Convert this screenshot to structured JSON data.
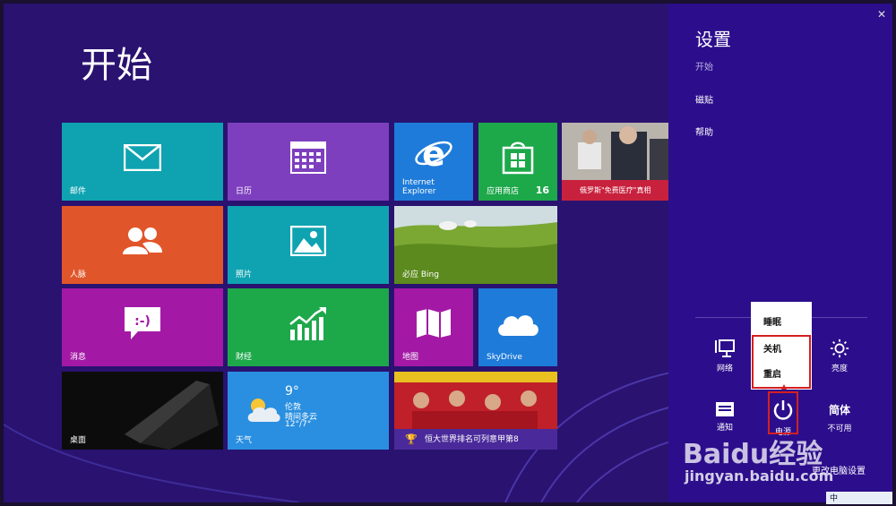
{
  "start": {
    "title": "开始"
  },
  "tiles": {
    "mail": {
      "label": "邮件",
      "color": "#0fa3b1"
    },
    "calendar": {
      "label": "日历",
      "color": "#7e3fbf"
    },
    "ie": {
      "label": "Internet Explorer",
      "color": "#1e7bd9"
    },
    "store": {
      "label": "应用商店",
      "badge": "16",
      "color": "#1da84a"
    },
    "news": {
      "label": "俄罗斯\"免费医疗\"真相",
      "color": "#c8213d"
    },
    "people": {
      "label": "人脉",
      "color": "#e0562a"
    },
    "photos": {
      "label": "照片",
      "color": "#0fa3b1"
    },
    "bing": {
      "label": "必应 Bing"
    },
    "messaging": {
      "label": "消息",
      "color": "#a319a6"
    },
    "finance": {
      "label": "财经",
      "color": "#1da84a"
    },
    "maps": {
      "label": "地图",
      "color": "#a319a6"
    },
    "skydrive": {
      "label": "SkyDrive",
      "color": "#1e7bd9"
    },
    "desktop": {
      "label": "桌面"
    },
    "weather": {
      "label": "天气",
      "temp": "9°",
      "city": "伦敦",
      "condition": "晴间多云",
      "range": "12°/7°",
      "color": "#2a8fe0"
    },
    "sports": {
      "label": "恒大世界排名可列意甲第8",
      "color": "#4a2a9a"
    }
  },
  "charm": {
    "title": "设置",
    "links": [
      "开始",
      "磁贴",
      "帮助"
    ],
    "close": "✕",
    "quick": {
      "network": "网络",
      "brightness": "亮度",
      "notifications": "通知",
      "power": "电源",
      "ime_label": "简体",
      "ime_status": "不可用"
    },
    "power_menu": [
      "睡眠",
      "关机",
      "重启"
    ],
    "change_settings": "更改电脑设置"
  },
  "watermark": {
    "brand": "Baidu经验",
    "url": "jingyan.baidu.com"
  },
  "tray": {
    "text": "中"
  }
}
